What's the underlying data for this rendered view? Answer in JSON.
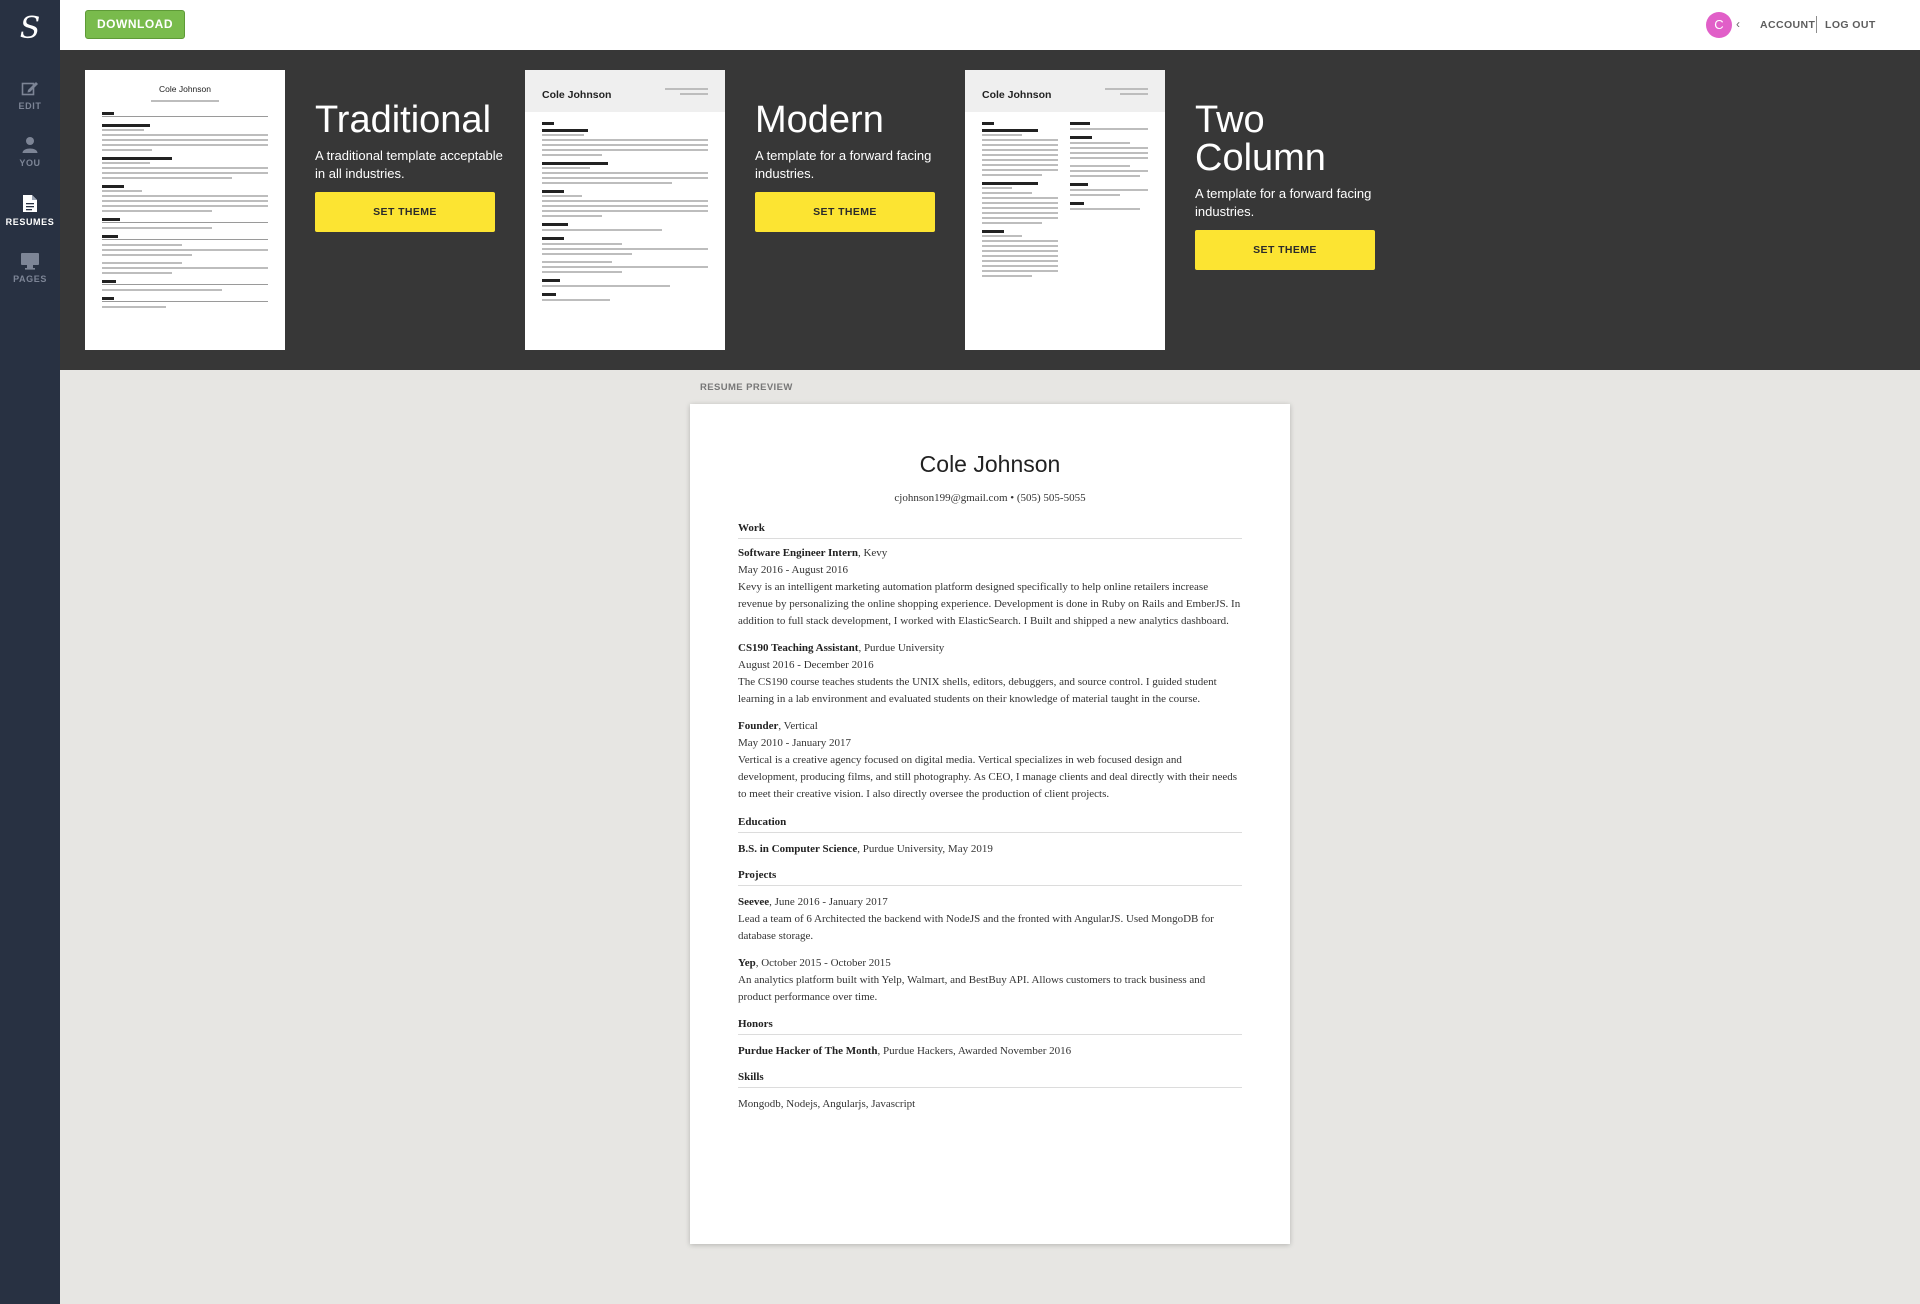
{
  "sidebar": {
    "logo": "S",
    "items": [
      {
        "label": "EDIT",
        "icon": "edit-icon"
      },
      {
        "label": "YOU",
        "icon": "user-icon"
      },
      {
        "label": "RESUMES",
        "icon": "document-icon",
        "active": true
      },
      {
        "label": "PAGES",
        "icon": "monitor-icon"
      }
    ]
  },
  "topbar": {
    "download_label": "DOWNLOAD",
    "avatar_initial": "C",
    "chevron": "‹",
    "account_label": "ACCOUNT",
    "logout_label": "LOG OUT"
  },
  "themes": [
    {
      "name": "Traditional",
      "description": "A traditional template acceptable in all industries.",
      "button": "SET THEME"
    },
    {
      "name": "Modern",
      "description": "A template for a forward facing industries.",
      "button": "SET THEME"
    },
    {
      "name": "Two Column",
      "description": "A template for a forward facing industries.",
      "button": "SET THEME"
    }
  ],
  "thumbnail": {
    "name": "Cole Johnson"
  },
  "preview": {
    "label": "RESUME PREVIEW",
    "name": "Cole Johnson",
    "contact": "cjohnson199@gmail.com • (505) 505-5055",
    "sections": {
      "work": "Work",
      "education": "Education",
      "projects": "Projects",
      "honors": "Honors",
      "skills": "Skills"
    },
    "work": [
      {
        "title": "Software Engineer Intern",
        "org": ", Kevy",
        "dates": "May 2016 - August 2016",
        "desc": [
          "Kevy is an intelligent marketing automation platform designed specifically to help online retailers increase",
          "revenue by personalizing the online shopping experience. Development is done in Ruby on Rails and EmberJS. In",
          "addition to full stack development, I worked with ElasticSearch. I Built and shipped a new analytics dashboard."
        ]
      },
      {
        "title": "CS190 Teaching Assistant",
        "org": ", Purdue University",
        "dates": "August 2016 - December 2016",
        "desc": [
          "The CS190 course teaches students the UNIX shells, editors, debuggers, and source control. I guided student",
          "learning in a lab environment and evaluated students on their knowledge of material taught in the course."
        ]
      },
      {
        "title": "Founder",
        "org": ", Vertical",
        "dates": "May 2010 - January 2017",
        "desc": [
          "Vertical is a creative agency focused on digital media. Vertical specializes in web focused design and",
          "development, producing films, and still photography. As CEO, I manage clients and deal directly with their needs",
          "to meet their creative vision. I also directly oversee the production of client projects."
        ]
      }
    ],
    "education": {
      "degree": "B.S. in Computer Science",
      "rest": ", Purdue University, May 2019"
    },
    "projects": [
      {
        "title": "Seevee",
        "dates": ", June 2016 - January 2017",
        "desc": [
          "Lead a team of 6 Architected the backend with NodeJS and the fronted with AngularJS. Used MongoDB for",
          "database storage."
        ]
      },
      {
        "title": "Yep",
        "dates": ", October 2015 - October 2015",
        "desc": [
          "An analytics platform built with Yelp, Walmart, and BestBuy API. Allows customers to track business and",
          "product performance over time."
        ]
      }
    ],
    "honors": {
      "title": "Purdue Hacker of The Month",
      "rest": ", Purdue Hackers, Awarded November 2016"
    },
    "skills": "Mongodb, Nodejs, Angularjs, Javascript"
  }
}
